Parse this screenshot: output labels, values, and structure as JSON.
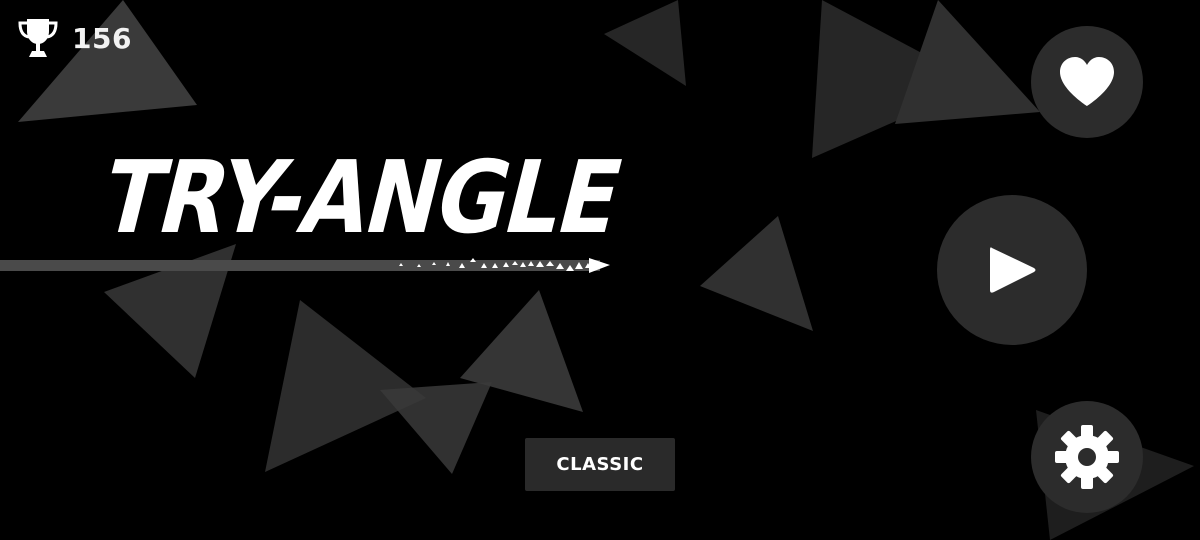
{
  "score": {
    "icon": "trophy-icon",
    "value": "156"
  },
  "title": "TRY-ANGLE",
  "buttons": {
    "like_icon": "heart-icon",
    "play_icon": "play-icon",
    "settings_icon": "gear-icon"
  },
  "mode_button": {
    "label": "CLASSIC"
  },
  "colors": {
    "background": "#000000",
    "foreground": "#ffffff",
    "button_fill": "#2c2c2c",
    "triangle_fill": "#3a3a3a"
  }
}
